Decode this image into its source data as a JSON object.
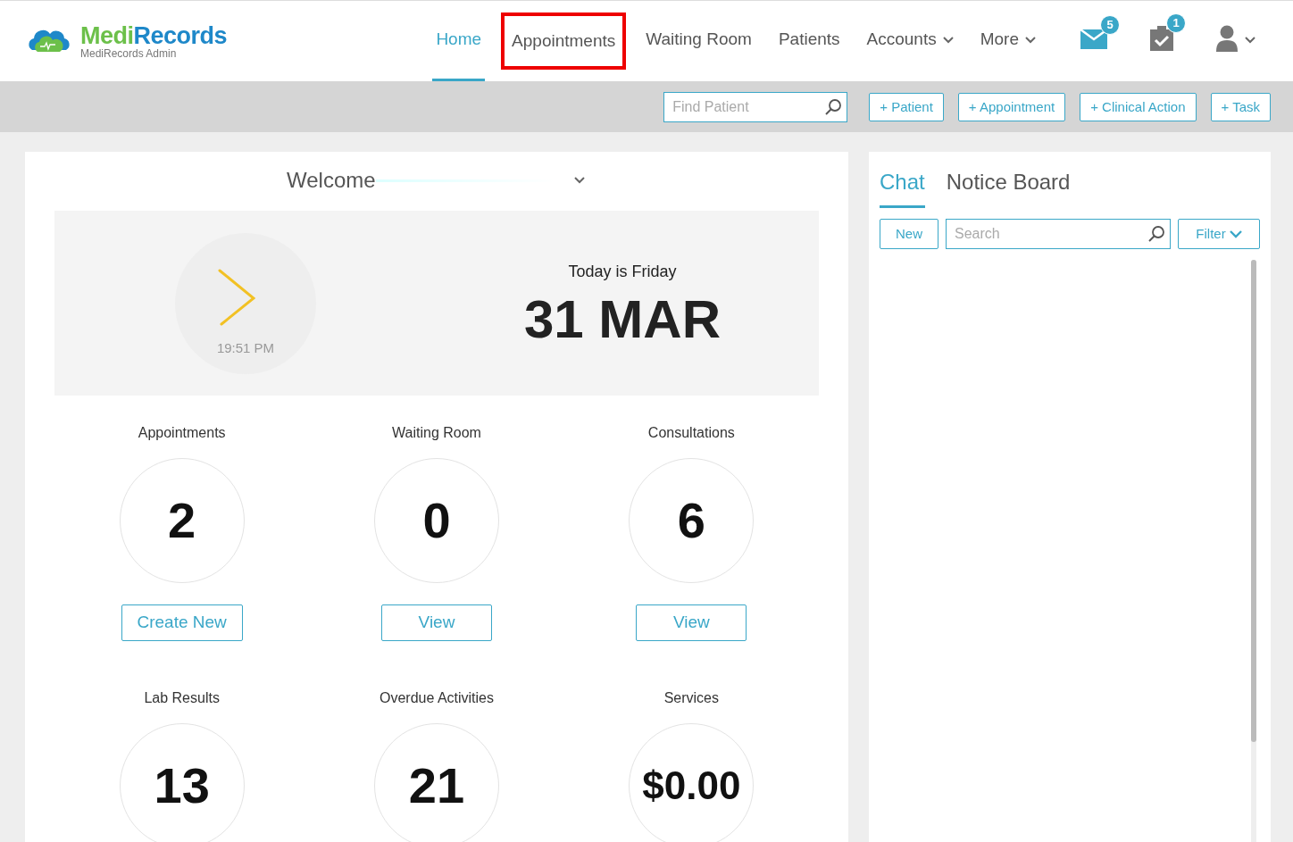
{
  "logo": {
    "part_1": "Medi",
    "part_2": "Records",
    "subtitle": "MediRecords Admin"
  },
  "nav": [
    {
      "label": "Home",
      "selected": true,
      "highlighted": false,
      "dropdown": false
    },
    {
      "label": "Appointments",
      "selected": false,
      "highlighted": true,
      "dropdown": false
    },
    {
      "label": "Waiting Room",
      "selected": false,
      "highlighted": false,
      "dropdown": false
    },
    {
      "label": "Patients",
      "selected": false,
      "highlighted": false,
      "dropdown": false
    },
    {
      "label": "Accounts",
      "selected": false,
      "highlighted": false,
      "dropdown": true
    },
    {
      "label": "More",
      "selected": false,
      "highlighted": false,
      "dropdown": true
    }
  ],
  "header_icons": [
    {
      "kind": "mail",
      "badge": "5"
    },
    {
      "kind": "tasks",
      "badge": "1"
    },
    {
      "kind": "user"
    }
  ],
  "toolbar": {
    "search": {
      "placeholder": "Find Patient"
    },
    "buttons": [
      "+ Patient",
      "+ Appointment",
      "+ Clinical Action",
      "+ Task"
    ]
  },
  "welcome": {
    "title": "Welcome",
    "clock_time": "19:51 PM",
    "today": "Today is Friday",
    "date": "31 MAR"
  },
  "stats": [
    {
      "label": "Appointments",
      "value": "2",
      "button": "Create New"
    },
    {
      "label": "Waiting Room",
      "value": "0",
      "button": "View"
    },
    {
      "label": "Consultations",
      "value": "6",
      "button": "View"
    },
    {
      "label": "Lab Results",
      "value": "13"
    },
    {
      "label": "Overdue Activities",
      "value": "21"
    },
    {
      "label": "Services",
      "value": "$0.00"
    }
  ],
  "side_tabs": [
    {
      "label": "Chat",
      "selected": true
    },
    {
      "label": "Notice Board",
      "selected": false
    }
  ],
  "chat": {
    "new_button": "New",
    "search": {
      "placeholder": "Search"
    },
    "filter_button": "Filter"
  }
}
